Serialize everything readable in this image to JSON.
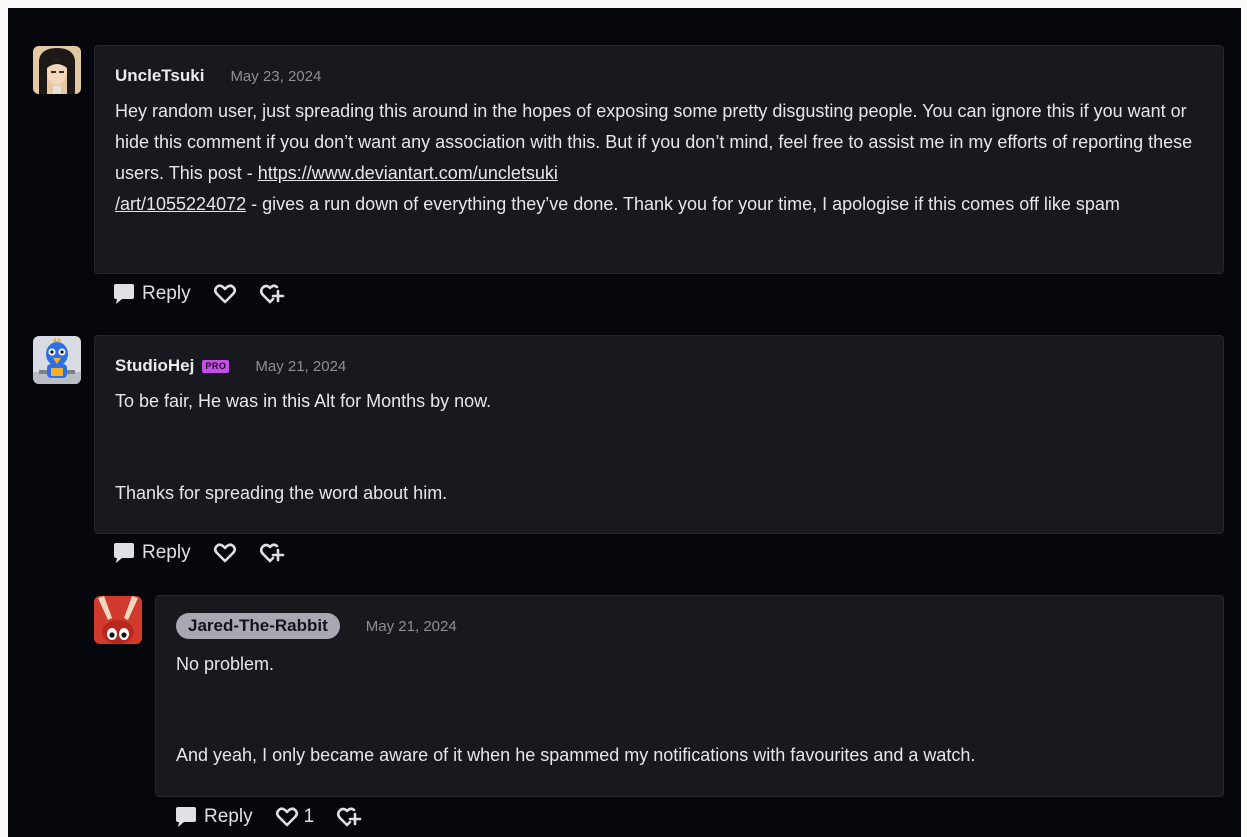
{
  "comments": [
    {
      "username": "UncleTsuki",
      "date": "May 23, 2024",
      "text_before_link": "Hey random user, just spreading this around in the hopes of exposing some pretty disgusting people. You can ignore this if you want or hide this comment if you don’t want any association with this. But if you don’t mind, feel free to assist me in my efforts of reporting these users. This post - ",
      "link_line1": "https://www.deviantart.com/uncletsuki",
      "link_line2": "/art/1055224072",
      "text_after_link": " - gives a run down of everything they’ve done. Thank you for your time, I apologise if this comes off like spam",
      "reply_label": "Reply",
      "avatar_icon": "anime-character-avatar"
    },
    {
      "username": "StudioHej",
      "badge": "PRO",
      "date": "May 21, 2024",
      "paragraph1": "To be fair, He was in this Alt for Months by now.",
      "paragraph2": "Thanks for spreading the word about him.",
      "reply_label": "Reply",
      "avatar_icon": "blue-bird-avatar"
    },
    {
      "username": "Jared-The-Rabbit",
      "date": "May 21, 2024",
      "paragraph1": "No problem.",
      "paragraph2": "And yeah, I only became aware of it when he spammed my notifications with favourites and a watch.",
      "reply_label": "Reply",
      "like_count": "1",
      "avatar_icon": "red-rabbit-avatar"
    }
  ],
  "icons": {
    "reply": "speech-bubble-icon",
    "like": "heart-icon",
    "favourite": "heart-plus-icon"
  },
  "colors": {
    "background": "#06070d",
    "card": "#17191f",
    "pro_badge": "#c54fe6",
    "op_pill": "#a8a8b3"
  }
}
